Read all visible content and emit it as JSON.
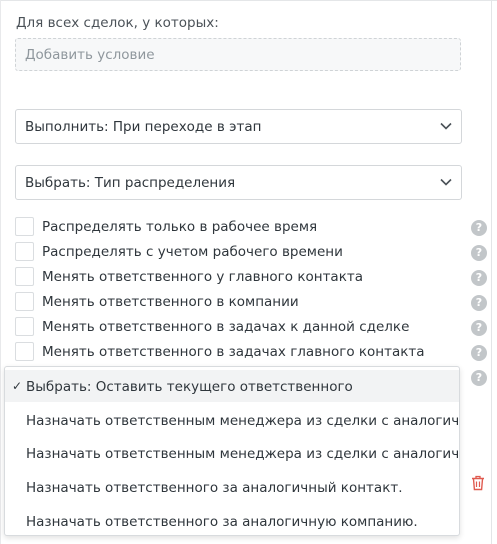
{
  "conditions": {
    "label": "Для всех сделок, у которых:",
    "add_placeholder": "Добавить условие"
  },
  "execute_select": {
    "value": "Выполнить: При переходе в этап"
  },
  "choose_select": {
    "value": "Выбрать: Тип распределения"
  },
  "options": [
    {
      "label": "Распределять только в рабочее время",
      "checked": false
    },
    {
      "label": "Распределять с учетом рабочего времени",
      "checked": false
    },
    {
      "label": "Менять ответственного у главного контакта",
      "checked": false
    },
    {
      "label": "Менять ответственного в компании",
      "checked": false
    },
    {
      "label": "Менять ответственного в задачах к данной сделке",
      "checked": false
    },
    {
      "label": "Менять ответственного в задачах главного контакта",
      "checked": false
    }
  ],
  "help_icon_glyph": "?",
  "dropdown": {
    "check_glyph": "✓",
    "items": [
      {
        "label": "Выбрать: Оставить текущего ответственного",
        "selected": true
      },
      {
        "label": "Назначать ответственным менеджера из сделки с аналогичным ко",
        "selected": false
      },
      {
        "label": "Назначать ответственным менеджера из сделки с аналогичной ко",
        "selected": false
      },
      {
        "label": "Назначать ответственного за аналогичный контакт.",
        "selected": false
      },
      {
        "label": "Назначать ответственного за аналогичную компанию.",
        "selected": false
      }
    ]
  },
  "colors": {
    "text": "#2f363c",
    "muted": "#8f979d",
    "border": "#d4d7da",
    "help_icon": "#c2c6c9",
    "delete_icon": "#e05a4f",
    "selected_bg": "#f2f3f4"
  }
}
